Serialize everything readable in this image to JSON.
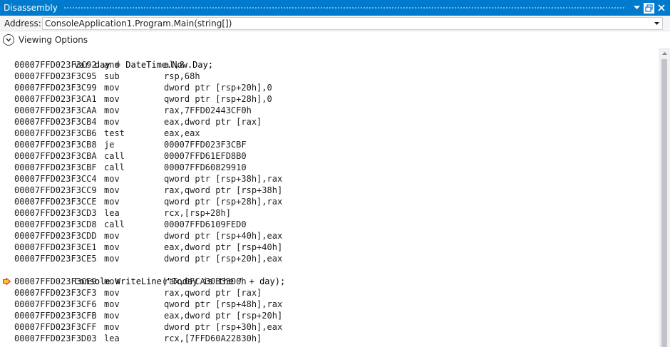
{
  "window": {
    "title": "Disassembly",
    "buttons": [
      "dropdown-icon",
      "restore-icon",
      "close-icon"
    ]
  },
  "address": {
    "label": "Address:",
    "value": "ConsoleApplication1.Program.Main(string[])"
  },
  "viewing_options": {
    "label": "Viewing Options"
  },
  "source_lines": {
    "line1": "var day = DateTime.Now.Day;",
    "line2": "Console.WriteLine(\"Today is the \" + day);"
  },
  "block1": [
    {
      "addr": "00007FFD023F3C92",
      "mn": "and",
      "ops": "al,8"
    },
    {
      "addr": "00007FFD023F3C95",
      "mn": "sub",
      "ops": "rsp,68h"
    },
    {
      "addr": "00007FFD023F3C99",
      "mn": "mov",
      "ops": "dword ptr [rsp+20h],0"
    },
    {
      "addr": "00007FFD023F3CA1",
      "mn": "mov",
      "ops": "qword ptr [rsp+28h],0"
    },
    {
      "addr": "00007FFD023F3CAA",
      "mn": "mov",
      "ops": "rax,7FFD02443CF0h"
    },
    {
      "addr": "00007FFD023F3CB4",
      "mn": "mov",
      "ops": "eax,dword ptr [rax]"
    },
    {
      "addr": "00007FFD023F3CB6",
      "mn": "test",
      "ops": "eax,eax"
    },
    {
      "addr": "00007FFD023F3CB8",
      "mn": "je",
      "ops": "00007FFD023F3CBF"
    },
    {
      "addr": "00007FFD023F3CBA",
      "mn": "call",
      "ops": "00007FFD61EFD8B0"
    },
    {
      "addr": "00007FFD023F3CBF",
      "mn": "call",
      "ops": "00007FFD60829910"
    },
    {
      "addr": "00007FFD023F3CC4",
      "mn": "mov",
      "ops": "qword ptr [rsp+38h],rax"
    },
    {
      "addr": "00007FFD023F3CC9",
      "mn": "mov",
      "ops": "rax,qword ptr [rsp+38h]"
    },
    {
      "addr": "00007FFD023F3CCE",
      "mn": "mov",
      "ops": "qword ptr [rsp+28h],rax"
    },
    {
      "addr": "00007FFD023F3CD3",
      "mn": "lea",
      "ops": "rcx,[rsp+28h]"
    },
    {
      "addr": "00007FFD023F3CD8",
      "mn": "call",
      "ops": "00007FFD6109FED0"
    },
    {
      "addr": "00007FFD023F3CDD",
      "mn": "mov",
      "ops": "dword ptr [rsp+40h],eax"
    },
    {
      "addr": "00007FFD023F3CE1",
      "mn": "mov",
      "ops": "eax,dword ptr [rsp+40h]"
    },
    {
      "addr": "00007FFD023F3CE5",
      "mn": "mov",
      "ops": "dword ptr [rsp+20h],eax"
    }
  ],
  "block2": [
    {
      "addr": "00007FFD023F3CE9",
      "mn": "mov",
      "ops": "rax,0FCA30B33D0h",
      "current": true
    },
    {
      "addr": "00007FFD023F3CF3",
      "mn": "mov",
      "ops": "rax,qword ptr [rax]"
    },
    {
      "addr": "00007FFD023F3CF6",
      "mn": "mov",
      "ops": "qword ptr [rsp+48h],rax"
    },
    {
      "addr": "00007FFD023F3CFB",
      "mn": "mov",
      "ops": "eax,dword ptr [rsp+20h]"
    },
    {
      "addr": "00007FFD023F3CFF",
      "mn": "mov",
      "ops": "dword ptr [rsp+30h],eax"
    },
    {
      "addr": "00007FFD023F3D03",
      "mn": "lea",
      "ops": "rcx,[7FFD60A22830h]"
    }
  ],
  "colors": {
    "title_bar": "#007acc",
    "current_arrow": "#f7c12f",
    "current_arrow_border": "#d22b2b"
  }
}
